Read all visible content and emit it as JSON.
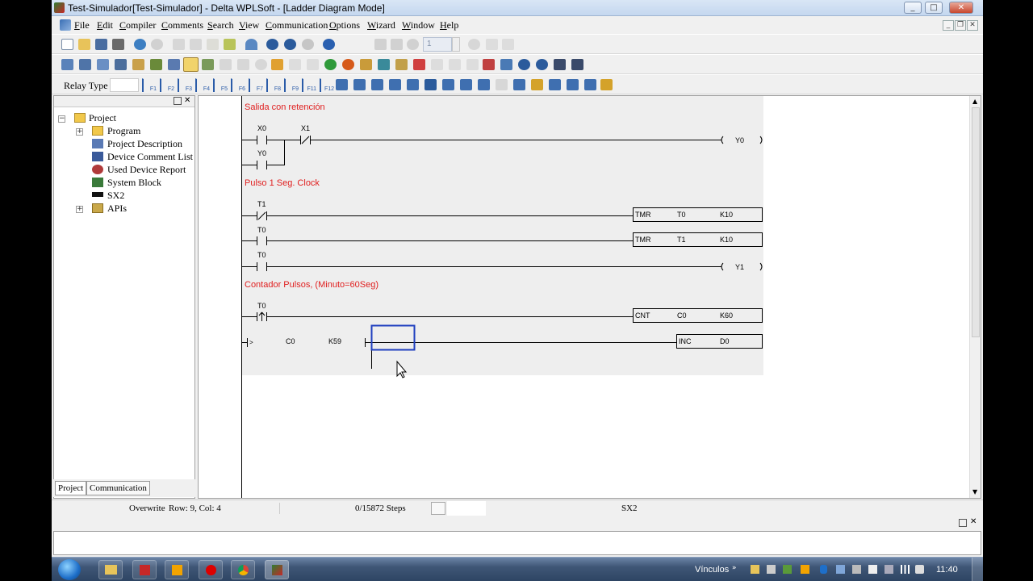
{
  "window": {
    "title": "Test-Simulador[Test-Simulador] - Delta WPLSoft - [Ladder Diagram Mode]"
  },
  "menu": [
    {
      "label": "File",
      "ul": "F",
      "rest": "ile"
    },
    {
      "label": "Edit",
      "ul": "E",
      "rest": "dit"
    },
    {
      "label": "Compiler",
      "ul": "C",
      "rest": "ompiler"
    },
    {
      "label": "Comments",
      "ul": "C",
      "rest": "omments"
    },
    {
      "label": "Search",
      "ul": "S",
      "rest": "earch"
    },
    {
      "label": "View",
      "ul": "V",
      "rest": "iew"
    },
    {
      "label": "Communication",
      "ul": "C",
      "rest": "ommunication"
    },
    {
      "label": "Options",
      "ul": "O",
      "rest": "ptions"
    },
    {
      "label": "Wizard",
      "ul": "W",
      "rest": "izard"
    },
    {
      "label": "Window",
      "ul": "W",
      "rest": "indow"
    },
    {
      "label": "Help",
      "ul": "H",
      "rest": "elp"
    }
  ],
  "toolbar3": {
    "relay_label": "Relay Type",
    "fkeys": [
      "F1",
      "F2",
      "F3",
      "F4",
      "F5",
      "F6",
      "F7",
      "F8",
      "F9",
      "F11",
      "F12"
    ]
  },
  "toolbar1": {
    "step_value": "1"
  },
  "tree": {
    "root": "Project",
    "items": [
      "Program",
      "Project Description",
      "Device Comment List",
      "Used Device Report",
      "System Block",
      "SX2",
      "APIs"
    ]
  },
  "left_tabs": [
    "Project",
    "Communication"
  ],
  "ladder": {
    "comments": [
      "Salida con retención",
      "Pulso 1 Seg. Clock",
      "Contador Pulsos, (Minuto=60Seg)"
    ],
    "contacts": {
      "x0": "X0",
      "x1": "X1",
      "y0": "Y0",
      "t1": "T1",
      "t0a": "T0",
      "t0b": "T0",
      "t0c": "T0"
    },
    "coils": {
      "y0": "Y0",
      "y1": "Y1"
    },
    "instr": [
      {
        "op": "TMR",
        "a": "T0",
        "b": "K10"
      },
      {
        "op": "TMR",
        "a": "T1",
        "b": "K10"
      },
      {
        "op": "CNT",
        "a": "C0",
        "b": "K60"
      },
      {
        "op": "INC",
        "a": "D0",
        "b": ""
      }
    ],
    "compare": {
      "op": ">",
      "a": "C0",
      "b": "K59"
    }
  },
  "status": {
    "mode": "Overwrite",
    "position": "Row: 9, Col: 4",
    "steps": "0/15872 Steps",
    "plc": "SX2"
  },
  "taskbar": {
    "links": "Vínculos",
    "time": "11:40"
  }
}
